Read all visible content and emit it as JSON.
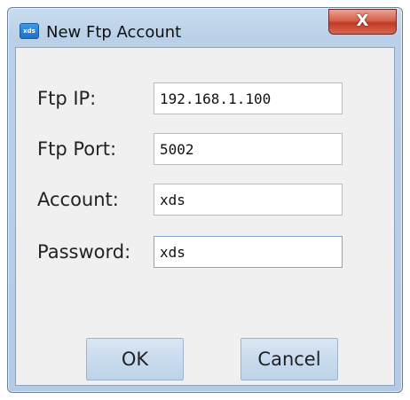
{
  "window": {
    "title": "New Ftp Account",
    "app_icon_text": "xds",
    "close_label": "X"
  },
  "form": {
    "fields": [
      {
        "label": "Ftp IP:",
        "value": "192.168.1.100"
      },
      {
        "label": "Ftp Port:",
        "value": "5002"
      },
      {
        "label": "Account:",
        "value": "xds"
      },
      {
        "label": "Password:",
        "value": "xds"
      }
    ]
  },
  "buttons": {
    "ok_label": "OK",
    "cancel_label": "Cancel"
  },
  "colors": {
    "frame": "#b3cbe4",
    "client": "#f0f0f0",
    "close_red": "#c23a24",
    "button": "#c9dbee"
  }
}
